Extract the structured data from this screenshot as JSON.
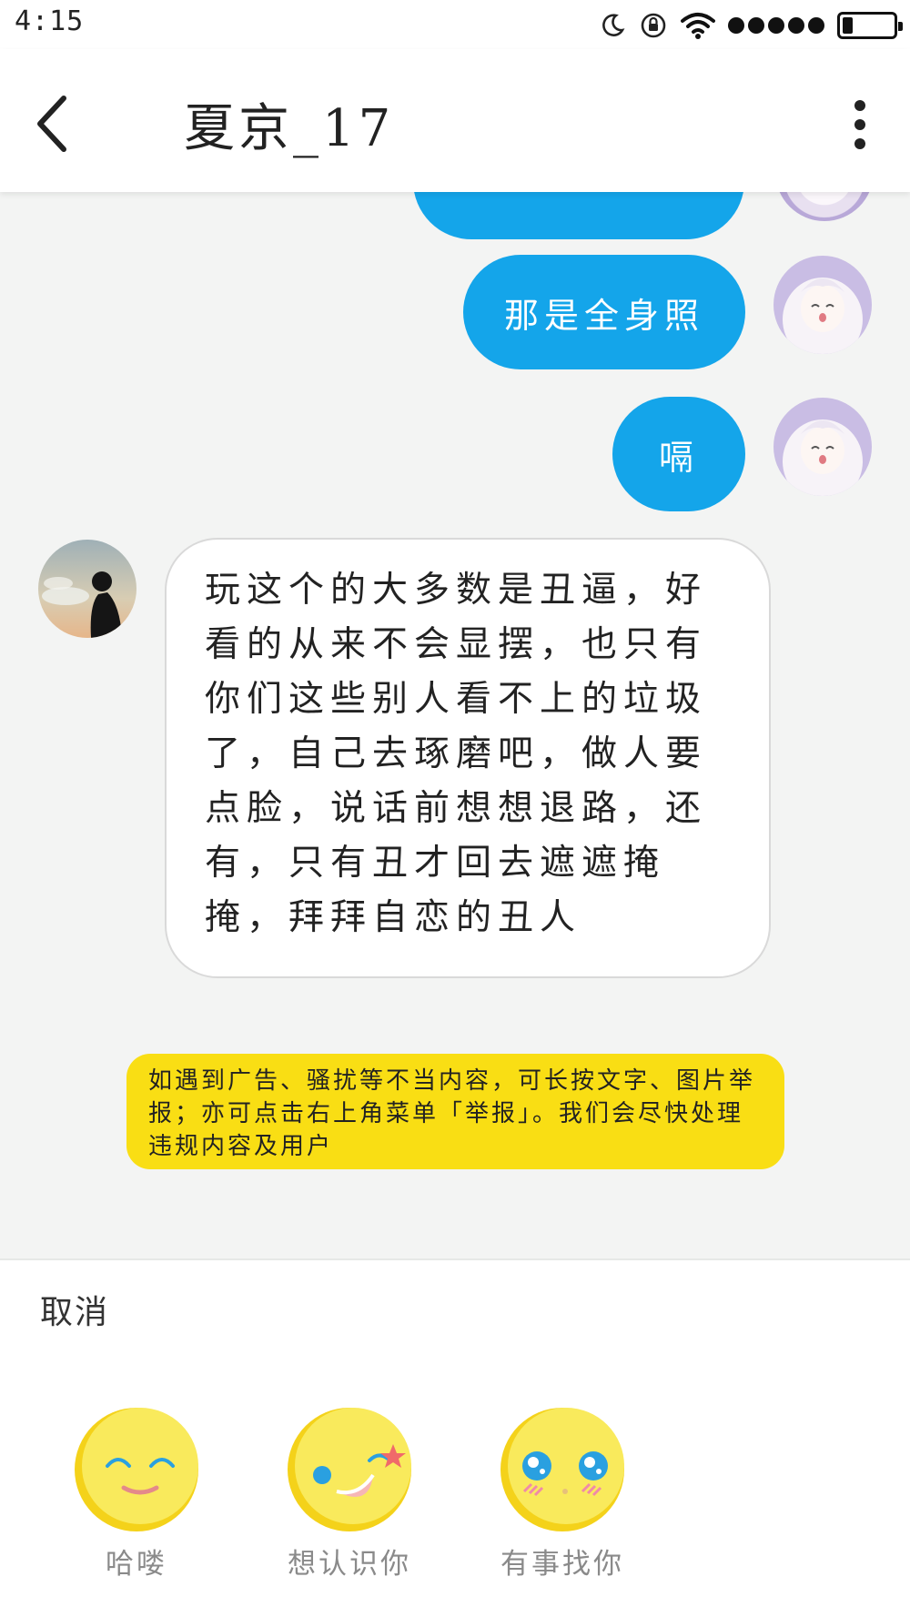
{
  "status_bar": {
    "time": "4:15",
    "icons": [
      "moon-icon",
      "rotation-lock-icon",
      "wifi-icon",
      "signal-dots-icon",
      "battery-icon"
    ],
    "battery_level": 0.2
  },
  "header": {
    "title": "夏京_17",
    "back_icon": "chevron-left-icon",
    "more_icon": "more-vertical-icon"
  },
  "messages": {
    "outgoing": [
      "那是全身照",
      "嗝"
    ],
    "incoming": "玩这个的大多数是丑逼，好看的从来不会显摆，也只有你们这些别人看不上的垃圾了，自己去琢磨吧，做人要点脸，说话前想想退路，还有，只有丑才回去遮遮掩掩，拜拜自恋的丑人"
  },
  "notice": {
    "text": "如遇到广告、骚扰等不当内容，可长按文字、图片举报；亦可点击右上角菜单「举报」。我们会尽快处理违规内容及用户"
  },
  "panel": {
    "cancel_label": "取消",
    "greetings": [
      {
        "label": "哈喽",
        "icon": "smile-face-icon"
      },
      {
        "label": "想认识你",
        "icon": "wink-face-icon"
      },
      {
        "label": "有事找你",
        "icon": "wide-eyes-face-icon"
      }
    ]
  },
  "colors": {
    "outgoing_bubble": "#14a5ea",
    "notice_background": "#f9de14",
    "emoji_yellow": "#f9ea5c"
  }
}
